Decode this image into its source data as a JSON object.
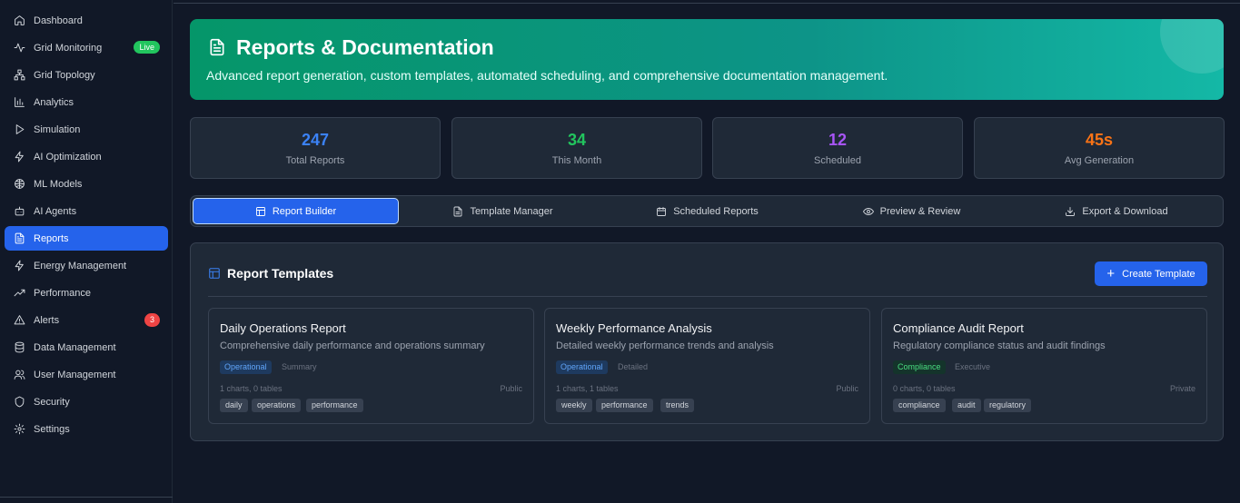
{
  "sidebar": {
    "items": [
      {
        "label": "Dashboard",
        "icon": "home-icon"
      },
      {
        "label": "Grid Monitoring",
        "icon": "activity-icon",
        "badge": "Live"
      },
      {
        "label": "Grid Topology",
        "icon": "network-icon"
      },
      {
        "label": "Analytics",
        "icon": "bar-chart-icon"
      },
      {
        "label": "Simulation",
        "icon": "play-icon"
      },
      {
        "label": "AI Optimization",
        "icon": "zap-icon"
      },
      {
        "label": "ML Models",
        "icon": "brain-icon"
      },
      {
        "label": "AI Agents",
        "icon": "bot-icon"
      },
      {
        "label": "Reports",
        "icon": "file-text-icon",
        "active": true
      },
      {
        "label": "Energy Management",
        "icon": "zap-icon"
      },
      {
        "label": "Performance",
        "icon": "trending-up-icon"
      },
      {
        "label": "Alerts",
        "icon": "alert-triangle-icon",
        "count": "3"
      },
      {
        "label": "Data Management",
        "icon": "database-icon"
      },
      {
        "label": "User Management",
        "icon": "users-icon"
      },
      {
        "label": "Security",
        "icon": "shield-icon"
      },
      {
        "label": "Settings",
        "icon": "gear-icon"
      }
    ]
  },
  "hero": {
    "title": "Reports & Documentation",
    "subtitle": "Advanced report generation, custom templates, automated scheduling, and comprehensive documentation management."
  },
  "stats": [
    {
      "value": "247",
      "label": "Total Reports",
      "color": "#3b82f6"
    },
    {
      "value": "34",
      "label": "This Month",
      "color": "#22c55e"
    },
    {
      "value": "12",
      "label": "Scheduled",
      "color": "#a855f7"
    },
    {
      "value": "45s",
      "label": "Avg Generation",
      "color": "#f97316"
    }
  ],
  "tabs": [
    {
      "label": "Report Builder",
      "icon": "layout-icon",
      "active": true
    },
    {
      "label": "Template Manager",
      "icon": "file-text-icon"
    },
    {
      "label": "Scheduled Reports",
      "icon": "calendar-icon"
    },
    {
      "label": "Preview & Review",
      "icon": "eye-icon"
    },
    {
      "label": "Export & Download",
      "icon": "download-icon"
    }
  ],
  "panel": {
    "title": "Report Templates",
    "create_label": "Create Template"
  },
  "templates": [
    {
      "title": "Daily Operations Report",
      "description": "Comprehensive daily performance and operations summary",
      "category": "Operational",
      "level": "Summary",
      "meta": "1 charts, 0 tables",
      "visibility": "Public",
      "tags": [
        "daily",
        "operations",
        "performance"
      ]
    },
    {
      "title": "Weekly Performance Analysis",
      "description": "Detailed weekly performance trends and analysis",
      "category": "Operational",
      "level": "Detailed",
      "meta": "1 charts, 1 tables",
      "visibility": "Public",
      "tags": [
        "weekly",
        "performance",
        "trends"
      ]
    },
    {
      "title": "Compliance Audit Report",
      "description": "Regulatory compliance status and audit findings",
      "category": "Compliance",
      "level": "Executive",
      "meta": "0 charts, 0 tables",
      "visibility": "Private",
      "tags": [
        "compliance",
        "audit",
        "regulatory"
      ]
    }
  ]
}
